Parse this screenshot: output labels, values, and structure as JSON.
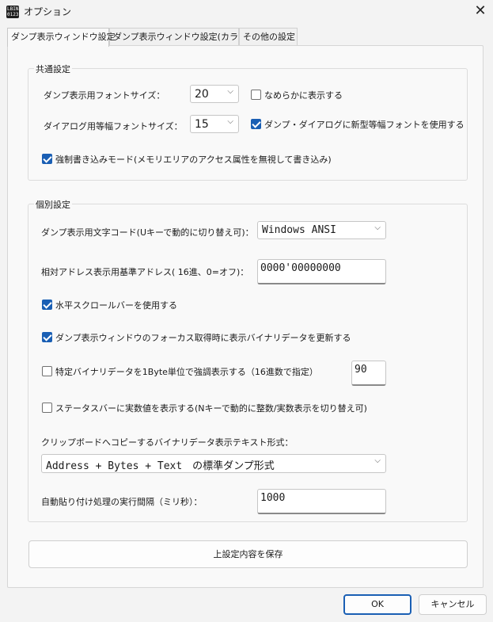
{
  "window": {
    "title": "オプション",
    "icon_text": [
      "LBIN",
      "0123"
    ]
  },
  "tabs": [
    {
      "label": "ダンプ表示ウィンドウ設定"
    },
    {
      "label": "ダンプ表示ウィンドウ設定(カラー)"
    },
    {
      "label": "その他の設定"
    }
  ],
  "common": {
    "title": "共通設定",
    "font_size_label": "ダンプ表示用フォントサイズ：",
    "font_size_value": "20",
    "smooth_label": "なめらかに表示する",
    "smooth_checked": false,
    "dialog_font_label": "ダイアログ用等幅フォントサイズ：",
    "dialog_font_value": "15",
    "new_font_label": "ダンプ・ダイアログに新型等幅フォントを使用する",
    "new_font_checked": true,
    "force_write_label": "強制書き込みモード(メモリエリアのアクセス属性を無視して書き込み)",
    "force_write_checked": true
  },
  "individual": {
    "title": "個別設定",
    "charcode_label": "ダンプ表示用文字コード(Uキーで動的に切り替え可)：",
    "charcode_value": "Windows ANSI",
    "base_addr_label": "相対アドレス表示用基準アドレス( 16進、0=オフ)：",
    "base_addr_value": "0000'00000000",
    "hscroll_label": "水平スクロールバーを使用する",
    "hscroll_checked": true,
    "focus_update_label": "ダンプ表示ウィンドウのフォーカス取得時に表示バイナリデータを更新する",
    "focus_update_checked": true,
    "highlight_label": "特定バイナリデータを1Byte単位で強調表示する（16進数で指定）",
    "highlight_checked": false,
    "highlight_value": "90",
    "statusbar_label": "ステータスバーに実数値を表示する(Nキーで動的に整数/実数表示を切り替え可)",
    "statusbar_checked": false,
    "clipboard_label": "クリップボードへコピーするバイナリデータ表示テキスト形式：",
    "clipboard_value": "Address + Bytes + Text　の標準ダンプ形式",
    "autopaste_label": "自動貼り付け処理の実行間隔（ミリ秒）：",
    "autopaste_value": "1000"
  },
  "save_button": "上設定内容を保存",
  "ok_button": "OK",
  "cancel_button": "キャンセル",
  "colors": {
    "accent": "#1a5fb4",
    "background": "#f3f3f3"
  }
}
